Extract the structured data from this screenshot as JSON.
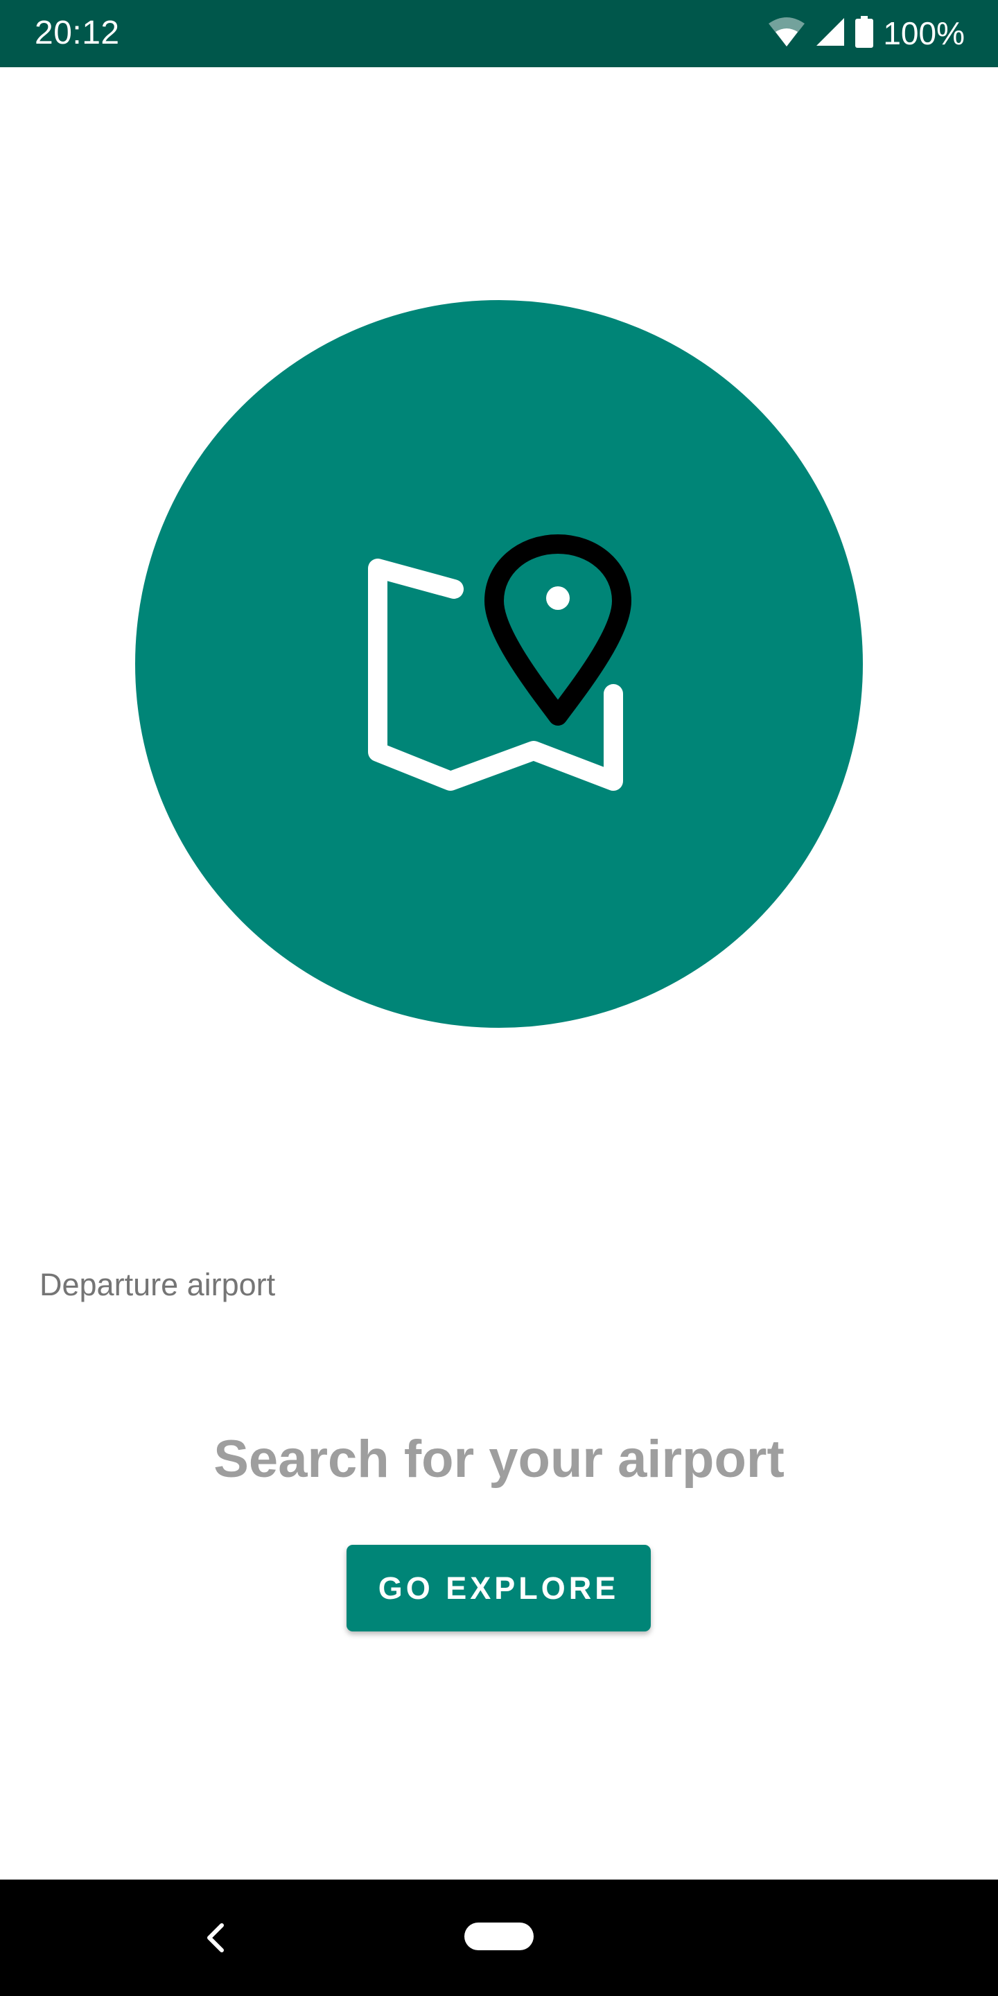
{
  "status_bar": {
    "time": "20:12",
    "battery": "100%",
    "icons": [
      "wifi-icon",
      "signal-icon",
      "battery-icon"
    ],
    "background": "#00574b"
  },
  "hero": {
    "icon": "map-pin-icon",
    "circle_color": "#008577"
  },
  "field": {
    "label": "Departure airport"
  },
  "empty_state": {
    "title": "Search for your airport",
    "button_label": "GO EXPLORE"
  },
  "nav_bar": {
    "icons": [
      "back-icon",
      "home-pill-icon"
    ]
  },
  "colors": {
    "accent": "#008577",
    "status_bar": "#00574b",
    "muted_text": "#9e9e9e",
    "label_text": "#757575"
  }
}
